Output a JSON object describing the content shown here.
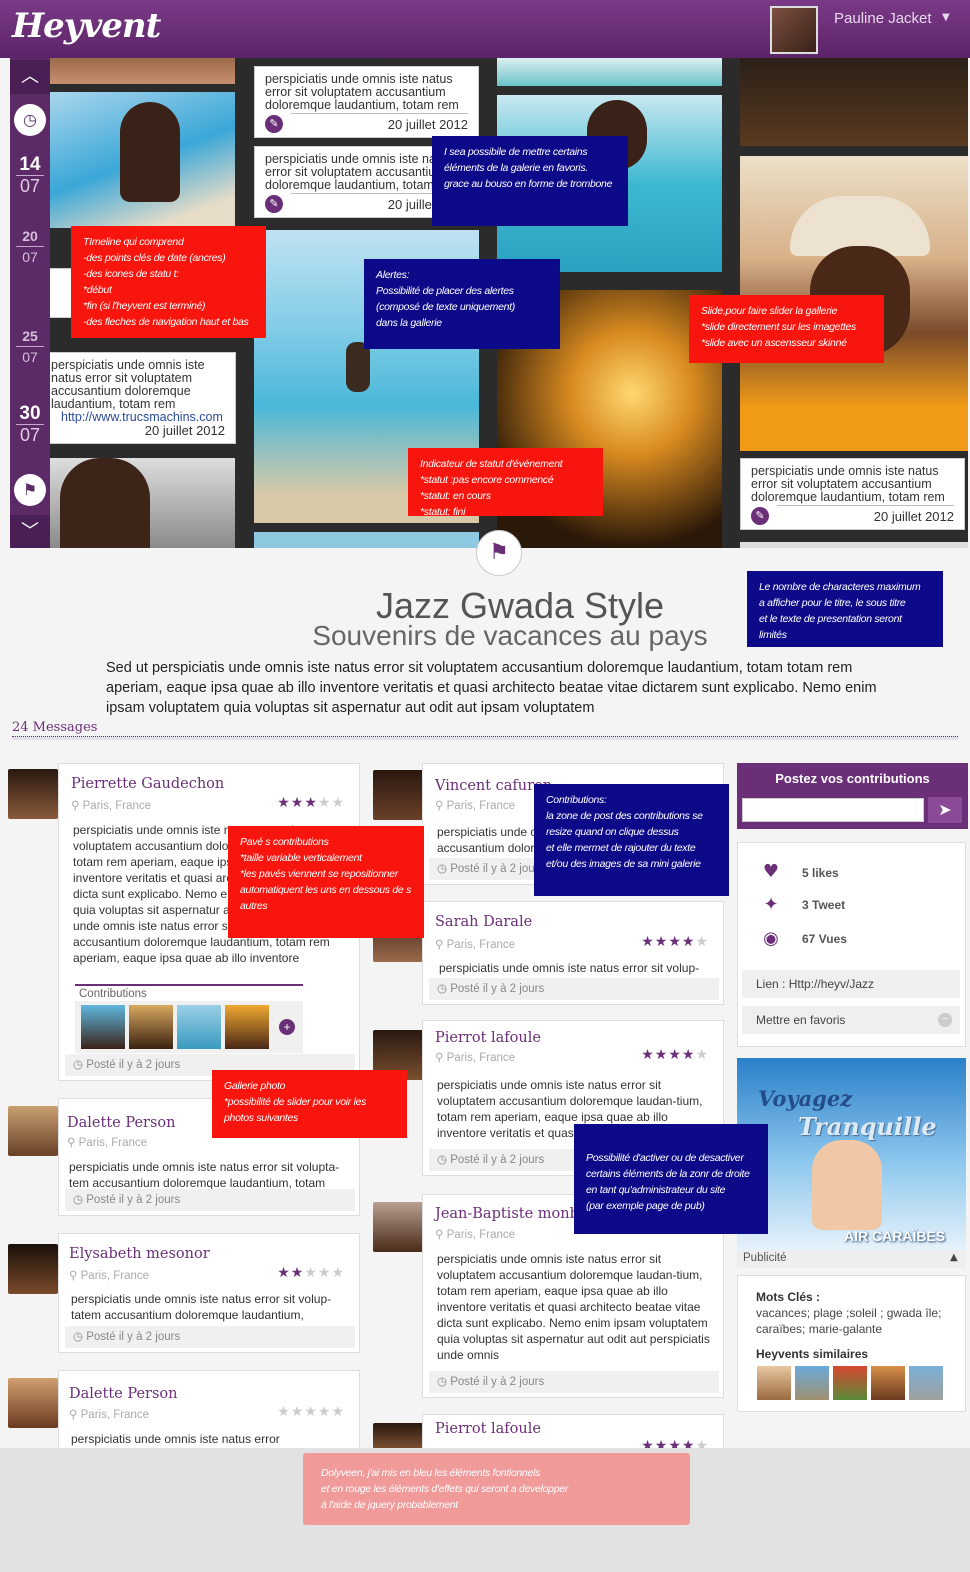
{
  "header": {
    "logo": "Heyvent",
    "user_name": "Pauline Jacket",
    "caret": "▼"
  },
  "timeline": {
    "up_icon": "chevron-up-icon",
    "down_icon": "chevron-down-icon",
    "status_icon": "clock-pin-icon",
    "end_icon": "flag-icon",
    "dates": [
      {
        "day": "14",
        "month": "07"
      },
      {
        "day": "20",
        "month": "07"
      },
      {
        "day": "25",
        "month": "07"
      },
      {
        "day": "30",
        "month": "07"
      }
    ]
  },
  "gallery_cards": [
    {
      "text": "perspiciatis unde omnis iste natus error sit voluptatem accusantium doloremque laudantium, totam rem",
      "date": "20 juillet 2012"
    },
    {
      "text": "perspiciatis unde omnis iste natus error sit voluptatem accusantium doloremque laudantium, totam rem",
      "date": "20 juillet 2012"
    },
    {
      "text": "perspiciatis unde omnis iste natus error sit voluptatem accusantium doloremque laudantium, totam rem",
      "link": "http://www.trucsmachins.com",
      "date": "20 juillet 2012"
    },
    {
      "text": "perspiciatis unde omnis iste natus error sit voluptatem accusantium doloremque laudantium, totam rem",
      "date": "20 juillet 2012"
    }
  ],
  "notes": {
    "favoris": "I sea possibile de mettre certains\néléments de la galerie en favoris.\ngrace au bouso en forme de trombone",
    "timeline": "TImeline qui comprend\n-des points clés  de date (ancres)\n-des icones de statu t:\n    *début\n    *fin (si l'heyvent est terminé)\n-des fleches de navigation haut et bas",
    "alertes": "Alertes:\nPossibilité de placer des alertes\n(composé de texte uniquement)\ndans la gallerie",
    "slide": "Slide,pour faire slider la gallerie\n*slide directement sur les imagettes\n*slide avec un ascensseur skinné",
    "indicateur": "Indicateur de statut d'événement\n*statut :pas encore commencé\n*statut: en cours\n*statut: fini",
    "characters": "Le nombre de characteres  maximum\na afficher pour le titre, le sous titre\net  le texte de presentation seront\nlimités",
    "contributions": "Contributions:\nla zone de post des contributions se\nresize quand on clique dessus\net elle mermet de rajouter du texte\net/ou des images  de sa mini galerie",
    "paves": "Pavé s contributions\n*taille variable verticalement\n*les pavés viennent se repositionner\nautomatiquent les uns en dessous de s\nautres",
    "galerie_photo": "Gallerie photo\n*possibilité de slider pour voir les\nphotos suivantes",
    "desactiver": "Possibilité d'activer ou de desactiver\ncertains éléments de la zonr de droite\nen tant qu'administrateur du site\n(par exemple page de pub)",
    "bottom": "Dolyveen, j'ai mis en bleu les éléments fontionnels\net en rouge les éléments d'effets qui seront a developper\nà l'aide de jquery probablement"
  },
  "event": {
    "title": "Jazz Gwada Style",
    "subtitle": "Souvenirs de vacances au pays",
    "description": "Sed ut perspiciatis unde omnis iste natus error sit voluptatem accusantium doloremque laudantium, totam totam rem aperiam, eaque ipsa quae ab illo inventore veritatis et quasi architecto beatae vitae dictarem sunt explicabo. Nemo enim ipsam voluptatem quia voluptas sit aspernatur aut odit aut ipsam voluptatem",
    "messages_count": "24 Messages"
  },
  "posts_left": [
    {
      "name": "Pierrette Gaudechon",
      "loc": "Paris, France",
      "stars_on": 3,
      "text": "perspiciatis unde omnis iste natus error sit voluptatem accusantium doloremque laudantium, totam rem aperiam, eaque ipsa quae ab illo inventore veritatis et quasi architecto beatae vitae dicta sunt explicabo. Nemo enim ipsam voluptatem quia voluptas sit aspernatur aut odit aut perspiciatis unde omnis iste natus error sit voluptatem accusantium doloremque laudantium, totam rem aperiam, eaque ipsa quae ab illo inventore",
      "contrib": "Contributions",
      "foot": "Posté il y à 2 jours"
    },
    {
      "name": "Dalette Person",
      "loc": "Paris, France",
      "stars_on": 0,
      "text": "perspiciatis unde omnis iste natus error sit volupta-tem accusantium doloremque laudantium, totam",
      "foot": "Posté il y à 2 jours"
    },
    {
      "name": "Elysabeth mesonor",
      "loc": "Paris, France",
      "stars_on": 2,
      "text": "perspiciatis unde omnis iste natus error sit volup-tatem accusantium doloremque laudantium,",
      "foot": "Posté il y à 2 jours"
    },
    {
      "name": "Dalette Person",
      "loc": "Paris, France",
      "stars_on": 0,
      "text": "perspiciatis unde omnis iste natus error",
      "foot": ""
    }
  ],
  "posts_mid": [
    {
      "name": "Vincent cafuron",
      "loc": "Paris, France",
      "stars_on": 0,
      "text": "perspiciatis unde omnis iste natus error sit tatem accusantium doloremque laudantium,",
      "foot": "Posté il y à 2 jours"
    },
    {
      "name": "Sarah Darale",
      "loc": "Paris, France",
      "stars_on": 4,
      "text": "perspiciatis unde omnis iste natus error sit volup-",
      "foot": "Posté il y à 2 jours"
    },
    {
      "name": "Pierrot lafoule",
      "loc": "Paris, France",
      "stars_on": 4,
      "text": "perspiciatis unde omnis iste natus error sit voluptatem accusantium doloremque laudan-tium, totam rem aperiam, eaque ipsa quae ab illo inventore veritatis et quasi",
      "foot": "Posté il y à 2 jours"
    },
    {
      "name": "Jean-Baptiste monbi",
      "loc": "Paris, France",
      "stars_on": 0,
      "text": "perspiciatis unde omnis iste natus error sit voluptatem accusantium doloremque laudan-tium, totam rem aperiam, eaque ipsa quae ab illo inventore veritatis et quasi architecto beatae vitae dicta sunt explicabo. Nemo enim ipsam voluptatem quia voluptas sit aspernatur aut odit aut perspiciatis unde omnis",
      "foot": "Posté il y à 2 jours"
    },
    {
      "name": "Pierrot lafoule",
      "loc": "Paris, France",
      "stars_on": 4,
      "text": "",
      "foot": ""
    }
  ],
  "sidebar": {
    "post_label": "Postez vos contributions",
    "likes": "5 likes",
    "tweets": "3 Tweet",
    "views": "67 Vues",
    "link": "Lien : Http://heyv/Jazz",
    "favorite": "Mettre en favoris",
    "ad_line1": "Voyagez",
    "ad_line2": "Tranquille",
    "ad_brand": "AIR CARAÏBES",
    "pub_label": "Publicité",
    "keywords_label": "Mots Clés :",
    "keywords": "vacances; plage ;soleil ; gwada île; caraïbes; marie-galante",
    "similar_label": "Heyvents similaires"
  },
  "colors": {
    "brand": "#6b2f78",
    "note_blue": "#0d0a8a",
    "note_red": "#f7150e"
  }
}
